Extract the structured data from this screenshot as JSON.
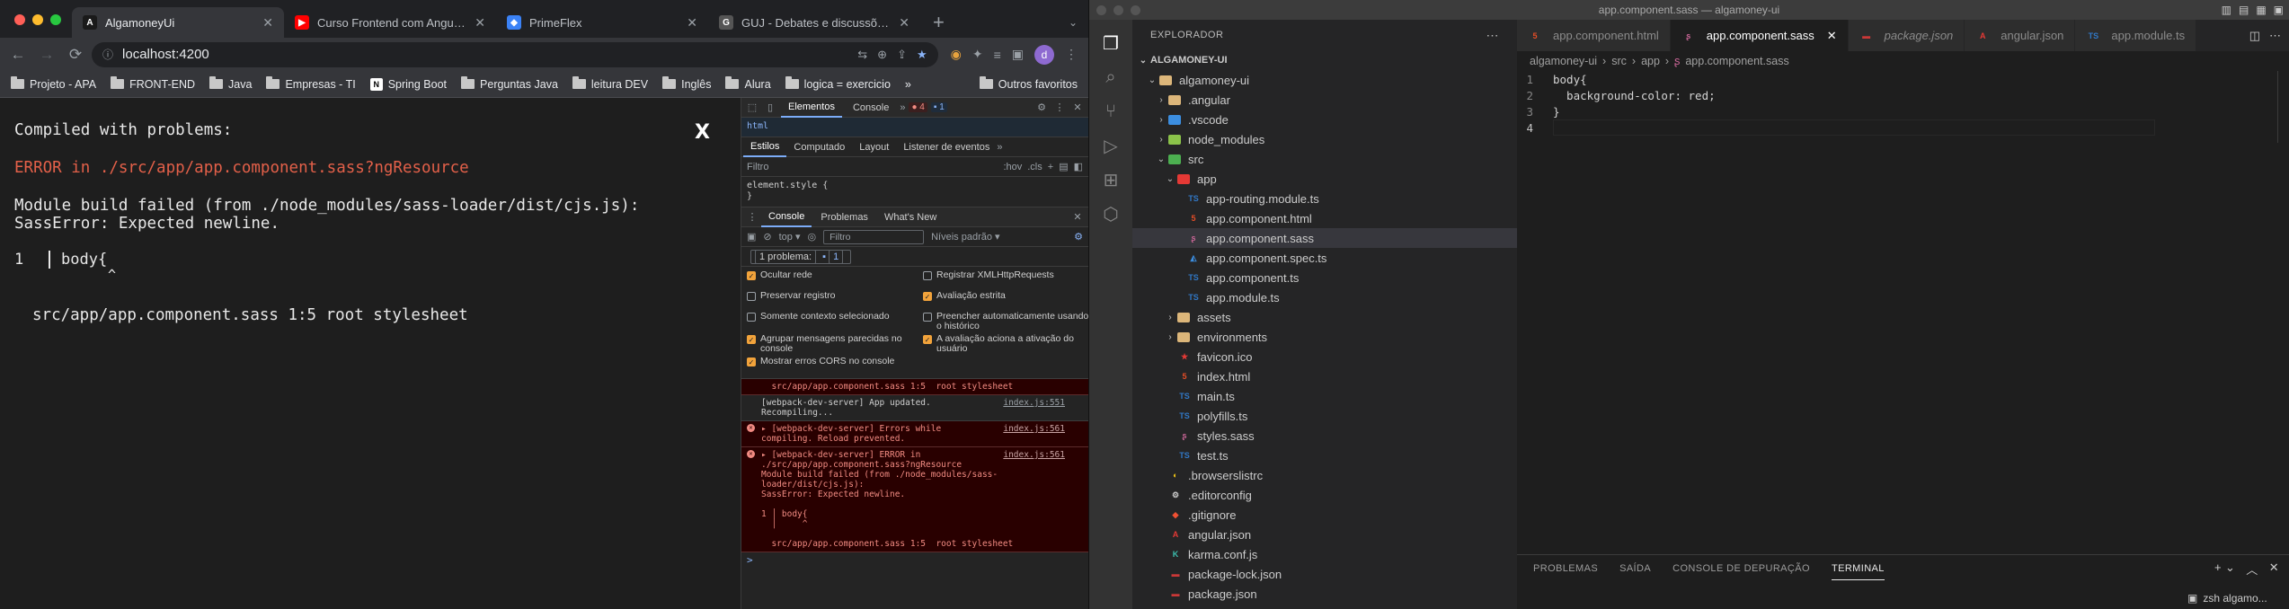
{
  "chrome": {
    "tabs": [
      {
        "title": "AlgamoneyUi",
        "icon": "angular-icon",
        "color": "#1a1a1a",
        "active": true
      },
      {
        "title": "Curso Frontend com Angular #",
        "icon": "youtube-icon",
        "color": "#ff0000",
        "active": false
      },
      {
        "title": "PrimeFlex",
        "icon": "primeflex-icon",
        "color": "#3b82f6",
        "active": false
      },
      {
        "title": "GUJ - Debates e discussões s",
        "icon": "guj-icon",
        "color": "#555555",
        "active": false
      }
    ],
    "new_tab": "+",
    "url": "localhost:4200",
    "avatar_letter": "d",
    "bookmarks": [
      {
        "label": "Projeto - APA",
        "icon": "folder-icon"
      },
      {
        "label": "FRONT-END",
        "icon": "folder-icon"
      },
      {
        "label": "Java",
        "icon": "folder-icon"
      },
      {
        "label": "Empresas - TI",
        "icon": "folder-icon"
      },
      {
        "label": "Spring Boot",
        "icon": "notion-icon"
      },
      {
        "label": "Perguntas Java",
        "icon": "folder-icon"
      },
      {
        "label": "leitura DEV",
        "icon": "folder-icon"
      },
      {
        "label": "Inglês",
        "icon": "folder-icon"
      },
      {
        "label": "Alura",
        "icon": "folder-icon"
      },
      {
        "label": "logica = exercicio",
        "icon": "folder-icon"
      }
    ],
    "bookmarks_more": "»",
    "other_favorites": "Outros favoritos"
  },
  "overlay": {
    "title": "Compiled with problems:",
    "close": "X",
    "error_line": "ERROR in ./src/app/app.component.sass?ngResource",
    "module_line": "Module build failed (from ./node_modules/sass-loader/dist/cjs.js):",
    "sass_error": "SassError: Expected newline.",
    "code_line_no": "1",
    "code_text": "body{",
    "caret": "^",
    "footer": "src/app/app.component.sass 1:5  root stylesheet"
  },
  "devtools": {
    "tabs": [
      "Elementos",
      "Console"
    ],
    "error_count": "4",
    "info_count": "1",
    "html_crumb": "html",
    "subtabs": [
      "Estilos",
      "Computado",
      "Layout",
      "Listener de eventos"
    ],
    "filter_placeholder": "Filtro",
    "hov": ":hov",
    "cls": ".cls",
    "element_style": "element.style {",
    "element_style_close": "}",
    "drawer_tabs": [
      "Console",
      "Problemas",
      "What's New"
    ],
    "context": "top",
    "console_filter": "Filtro",
    "levels": "Níveis padrão",
    "problems": "1 problema:",
    "problems_count": "1",
    "settings": [
      {
        "label": "Ocultar rede",
        "checked": true
      },
      {
        "label": "Registrar XMLHttpRequests",
        "checked": false
      },
      {
        "label": "Preservar registro",
        "checked": false
      },
      {
        "label": "Avaliação estrita",
        "checked": true
      },
      {
        "label": "Somente contexto selecionado",
        "checked": false
      },
      {
        "label": "Preencher automaticamente usando o histórico",
        "checked": false
      },
      {
        "label": "Agrupar mensagens parecidas no console",
        "checked": true
      },
      {
        "label": "A avaliação aciona a ativação do usuário",
        "checked": true
      },
      {
        "label": "Mostrar erros CORS no console",
        "checked": true
      }
    ],
    "messages": [
      {
        "type": "err",
        "icon": false,
        "text": "  src/app/app.component.sass 1:5  root stylesheet",
        "source": ""
      },
      {
        "type": "inf",
        "icon": false,
        "text": "[webpack-dev-server] App updated.\nRecompiling...",
        "source": "index.js:551"
      },
      {
        "type": "err",
        "icon": true,
        "text": "▸ [webpack-dev-server] Errors while\ncompiling. Reload prevented.",
        "source": "index.js:561"
      },
      {
        "type": "err",
        "icon": true,
        "text": "▸ [webpack-dev-server] ERROR in\n./src/app/app.component.sass?ngResource\nModule build failed (from ./node_modules/sass-\nloader/dist/cjs.js):\nSassError: Expected newline.\n\n1 │ body{\n  │     ^\n\n  src/app/app.component.sass 1:5  root stylesheet",
        "source": "index.js:561"
      }
    ],
    "prompt": ">"
  },
  "vscode": {
    "window_title": "app.component.sass — algamoney-ui",
    "explorer_title": "EXPLORADOR",
    "root": "ALGAMONEY-UI",
    "tree": [
      {
        "label": "algamoney-ui",
        "depth": 1,
        "chev": "⌄",
        "icon": "folder-icon",
        "color": "#dcb67a",
        "sel": false
      },
      {
        "label": ".angular",
        "depth": 2,
        "chev": "›",
        "icon": "folder-icon",
        "color": "#dcb67a",
        "sel": false
      },
      {
        "label": ".vscode",
        "depth": 2,
        "chev": "›",
        "icon": "vscode-folder-icon",
        "color": "#3c8ee0",
        "sel": false
      },
      {
        "label": "node_modules",
        "depth": 2,
        "chev": "›",
        "icon": "node-folder-icon",
        "color": "#8bc34a",
        "sel": false
      },
      {
        "label": "src",
        "depth": 2,
        "chev": "⌄",
        "icon": "src-folder-icon",
        "color": "#4caf50",
        "sel": false
      },
      {
        "label": "app",
        "depth": 3,
        "chev": "⌄",
        "icon": "app-folder-icon",
        "color": "#e53935",
        "sel": false
      },
      {
        "label": "app-routing.module.ts",
        "depth": 4,
        "chev": "",
        "icon": "ts-file-icon",
        "color": "#3178c6",
        "sel": false
      },
      {
        "label": "app.component.html",
        "depth": 4,
        "chev": "",
        "icon": "html-file-icon",
        "color": "#e44d26",
        "sel": false
      },
      {
        "label": "app.component.sass",
        "depth": 4,
        "chev": "",
        "icon": "sass-file-icon",
        "color": "#cd6799",
        "sel": true
      },
      {
        "label": "app.component.spec.ts",
        "depth": 4,
        "chev": "",
        "icon": "spec-file-icon",
        "color": "#3c8ee0",
        "sel": false
      },
      {
        "label": "app.component.ts",
        "depth": 4,
        "chev": "",
        "icon": "ts-file-icon",
        "color": "#3178c6",
        "sel": false
      },
      {
        "label": "app.module.ts",
        "depth": 4,
        "chev": "",
        "icon": "ts-file-icon",
        "color": "#3178c6",
        "sel": false
      },
      {
        "label": "assets",
        "depth": 3,
        "chev": "›",
        "icon": "folder-icon",
        "color": "#dcb67a",
        "sel": false
      },
      {
        "label": "environments",
        "depth": 3,
        "chev": "›",
        "icon": "folder-icon",
        "color": "#dcb67a",
        "sel": false
      },
      {
        "label": "favicon.ico",
        "depth": 3,
        "chev": "",
        "icon": "favicon-file-icon",
        "color": "#e53935",
        "sel": false
      },
      {
        "label": "index.html",
        "depth": 3,
        "chev": "",
        "icon": "html-file-icon",
        "color": "#e44d26",
        "sel": false
      },
      {
        "label": "main.ts",
        "depth": 3,
        "chev": "",
        "icon": "ts-file-icon",
        "color": "#3178c6",
        "sel": false
      },
      {
        "label": "polyfills.ts",
        "depth": 3,
        "chev": "",
        "icon": "ts-file-icon",
        "color": "#3178c6",
        "sel": false
      },
      {
        "label": "styles.sass",
        "depth": 3,
        "chev": "",
        "icon": "sass-file-icon",
        "color": "#cd6799",
        "sel": false
      },
      {
        "label": "test.ts",
        "depth": 3,
        "chev": "",
        "icon": "ts-file-icon",
        "color": "#3178c6",
        "sel": false
      },
      {
        "label": ".browserslistrc",
        "depth": 2,
        "chev": "",
        "icon": "browserslist-file-icon",
        "color": "#f6c915",
        "sel": false
      },
      {
        "label": ".editorconfig",
        "depth": 2,
        "chev": "",
        "icon": "editorconfig-file-icon",
        "color": "#cccccc",
        "sel": false
      },
      {
        "label": ".gitignore",
        "depth": 2,
        "chev": "",
        "icon": "git-file-icon",
        "color": "#f05033",
        "sel": false
      },
      {
        "label": "angular.json",
        "depth": 2,
        "chev": "",
        "icon": "angular-file-icon",
        "color": "#e53935",
        "sel": false
      },
      {
        "label": "karma.conf.js",
        "depth": 2,
        "chev": "",
        "icon": "karma-file-icon",
        "color": "#3cbeae",
        "sel": false
      },
      {
        "label": "package-lock.json",
        "depth": 2,
        "chev": "",
        "icon": "npm-file-icon",
        "color": "#cb3837",
        "sel": false
      },
      {
        "label": "package.json",
        "depth": 2,
        "chev": "",
        "icon": "npm-file-icon",
        "color": "#cb3837",
        "sel": false
      }
    ],
    "editor_tabs": [
      {
        "label": "app.component.html",
        "icon": "html-file-icon",
        "color": "#e44d26",
        "active": false,
        "italic": false
      },
      {
        "label": "app.component.sass",
        "icon": "sass-file-icon",
        "color": "#cd6799",
        "active": true,
        "italic": false
      },
      {
        "label": "package.json",
        "icon": "npm-file-icon",
        "color": "#cb3837",
        "active": false,
        "italic": true
      },
      {
        "label": "angular.json",
        "icon": "angular-file-icon",
        "color": "#e53935",
        "active": false,
        "italic": false
      },
      {
        "label": "app.module.ts",
        "icon": "ts-file-icon",
        "color": "#3178c6",
        "active": false,
        "italic": false
      }
    ],
    "breadcrumbs": [
      "algamoney-ui",
      "src",
      "app",
      "app.component.sass"
    ],
    "code": [
      {
        "n": "1",
        "text": "body{"
      },
      {
        "n": "2",
        "text": "  background-color: red;"
      },
      {
        "n": "3",
        "text": "}"
      },
      {
        "n": "4",
        "text": ""
      }
    ],
    "panel_tabs": [
      "PROBLEMAS",
      "SAÍDA",
      "CONSOLE DE DEPURAÇÃO",
      "TERMINAL"
    ],
    "terminal_label": "zsh  algamo..."
  }
}
